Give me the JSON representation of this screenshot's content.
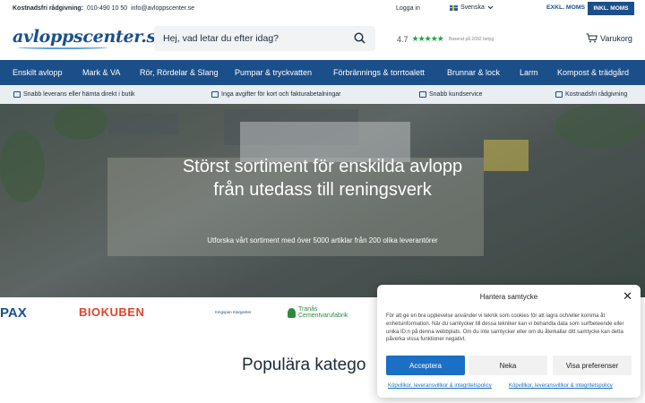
{
  "topbar": {
    "contact_label": "Kostnadsfri rådgivning:",
    "phone": "010-490 10 50",
    "email": "info@avloppscenter.se",
    "login": "Logga in",
    "language": "Svenska",
    "exkl_moms": "EXKL. MOMS",
    "inkl_moms": "INKL. MOMS"
  },
  "header": {
    "logo_text": "avloppscenter.se",
    "search_placeholder": "Hej, vad letar du efter idag?",
    "rating_score": "4.7",
    "rating_stars": "★★★★★",
    "rating_count": "Baserat på 2092 betyg",
    "cart_label": "Varukorg"
  },
  "nav": {
    "items": [
      "Enskilt avlopp",
      "Mark & VA",
      "Rör, Rördelar & Slang",
      "Pumpar & tryckvatten",
      "Förbrännings & torrtoalett",
      "Brunnar & lock",
      "Larm",
      "Kompost & trädgård"
    ]
  },
  "usp": {
    "items": [
      "Snabb leverans eller hämta direkt i butik",
      "Inga avgifter för kort och fakturabetalningar",
      "Snabb kundservice",
      "Kostnadsfri rådgivning"
    ]
  },
  "hero": {
    "heading": "Störst sortiment för enskilda avlopp från utedass till reningsverk",
    "subtext": "Utforska vårt sortiment med över 5000 artiklar från 200 olika leverantörer"
  },
  "brands": {
    "items": [
      "PAX",
      "BIOKUBEN",
      "Kingspan Klargester",
      "Tranås Cementvarufabrik"
    ]
  },
  "popular": {
    "heading": "Populära katego"
  },
  "cookie": {
    "title": "Hantera samtycke",
    "close": "✕",
    "body": "För att ge en bra upplevelse använder vi teknik som cookies för att lagra och/eller komma åt enhetsinformation. När du samtycker till dessa tekniker kan vi behandla data som surfbeteende eller unika ID:n på denna webbplats. Om du inte samtycker eller om du återkallar ditt samtycke kan detta påverka vissa funktioner negativt.",
    "accept": "Acceptera",
    "deny": "Neka",
    "preferences": "Visa preferenser",
    "link1": "Köpvillkor, leveransvillkor & integritetspolicy",
    "link2": "Köpvillkor, leveransvillkor & integritetspolicy"
  },
  "colors": {
    "brand_blue": "#1b4f8a",
    "accent_blue": "#1b6fc4",
    "star_green": "#1fa34a"
  }
}
